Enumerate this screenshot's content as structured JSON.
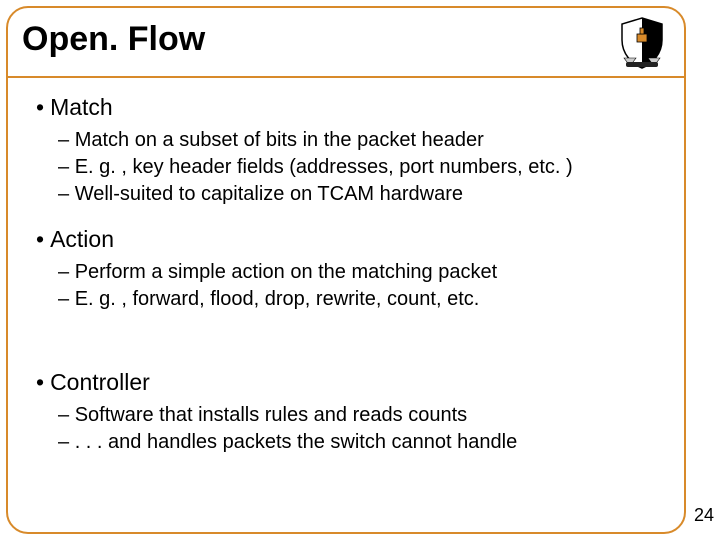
{
  "title": "Open. Flow",
  "sections": [
    {
      "heading": "Match",
      "items": [
        "Match on a subset of bits in the packet header",
        "E. g. , key header fields (addresses, port numbers, etc. )",
        "Well-suited to capitalize on TCAM hardware"
      ]
    },
    {
      "heading": "Action",
      "items": [
        "Perform a simple action on the matching packet",
        "E. g. , forward, flood, drop, rewrite, count, etc."
      ]
    },
    {
      "heading": "Controller",
      "items": [
        "Software that installs rules and reads counts",
        ". . . and handles packets the switch cannot handle"
      ]
    }
  ],
  "page_number": "24",
  "spacer_heights": [
    "0px",
    "38px",
    "0px"
  ]
}
